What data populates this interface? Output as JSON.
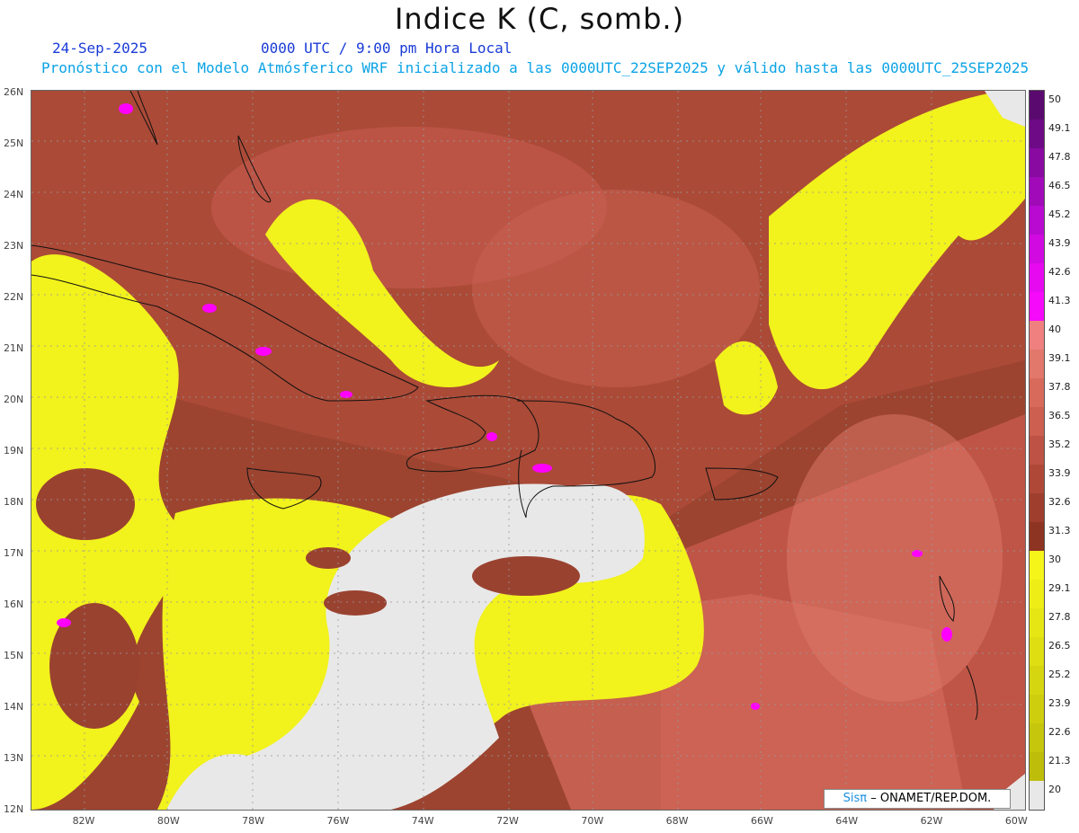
{
  "header": {
    "title": "Indice K (C, somb.)",
    "date": "24-Sep-2025",
    "time": "0000 UTC / 9:00 pm Hora Local",
    "forecast_line": "Pronóstico con el Modelo Atmósferico WRF inicializado a las 0000UTC_22SEP2025 y válido hasta las  0000UTC_25SEP2025"
  },
  "map": {
    "lat_labels": [
      "26N",
      "25N",
      "24N",
      "23N",
      "22N",
      "21N",
      "20N",
      "19N",
      "18N",
      "17N",
      "16N",
      "15N",
      "14N",
      "13N",
      "12N"
    ],
    "lon_labels": [
      "82W",
      "80W",
      "78W",
      "76W",
      "74W",
      "72W",
      "70W",
      "68W",
      "66W",
      "64W",
      "62W",
      "60W"
    ],
    "colors": {
      "below_20": "#e8e8e8",
      "yellow": "#f5f51a",
      "brown_dark": "#8c3a24",
      "brown_mid": "#b8503e",
      "red_light": "#d86a5c",
      "pink": "#e87a70",
      "magenta": "#ff00ff"
    }
  },
  "colorbar": {
    "labels": [
      "50",
      "49.1",
      "47.8",
      "46.5",
      "45.2",
      "43.9",
      "42.6",
      "41.3",
      "40",
      "39.1",
      "37.8",
      "36.5",
      "35.2",
      "33.9",
      "32.6",
      "31.3",
      "30",
      "29.1",
      "27.8",
      "26.5",
      "25.2",
      "23.9",
      "22.6",
      "21.3",
      "20"
    ],
    "colors": [
      "#5a0a6e",
      "#6e0a86",
      "#880aa0",
      "#a00ab8",
      "#b80ad0",
      "#d00ae0",
      "#e60af0",
      "#f50afa",
      "#f08080",
      "#e2776b",
      "#d86a5c",
      "#cc5f50",
      "#be5244",
      "#b04838",
      "#a03e2e",
      "#8e3422",
      "#f5f51a",
      "#eeee16",
      "#e6e614",
      "#dede12",
      "#d6d610",
      "#cece0e",
      "#c6c60c",
      "#bebe0a",
      "#e8e8e8"
    ]
  },
  "credit": {
    "brand": "Sisπ",
    "text": "– ONAMET/REP.DOM."
  }
}
